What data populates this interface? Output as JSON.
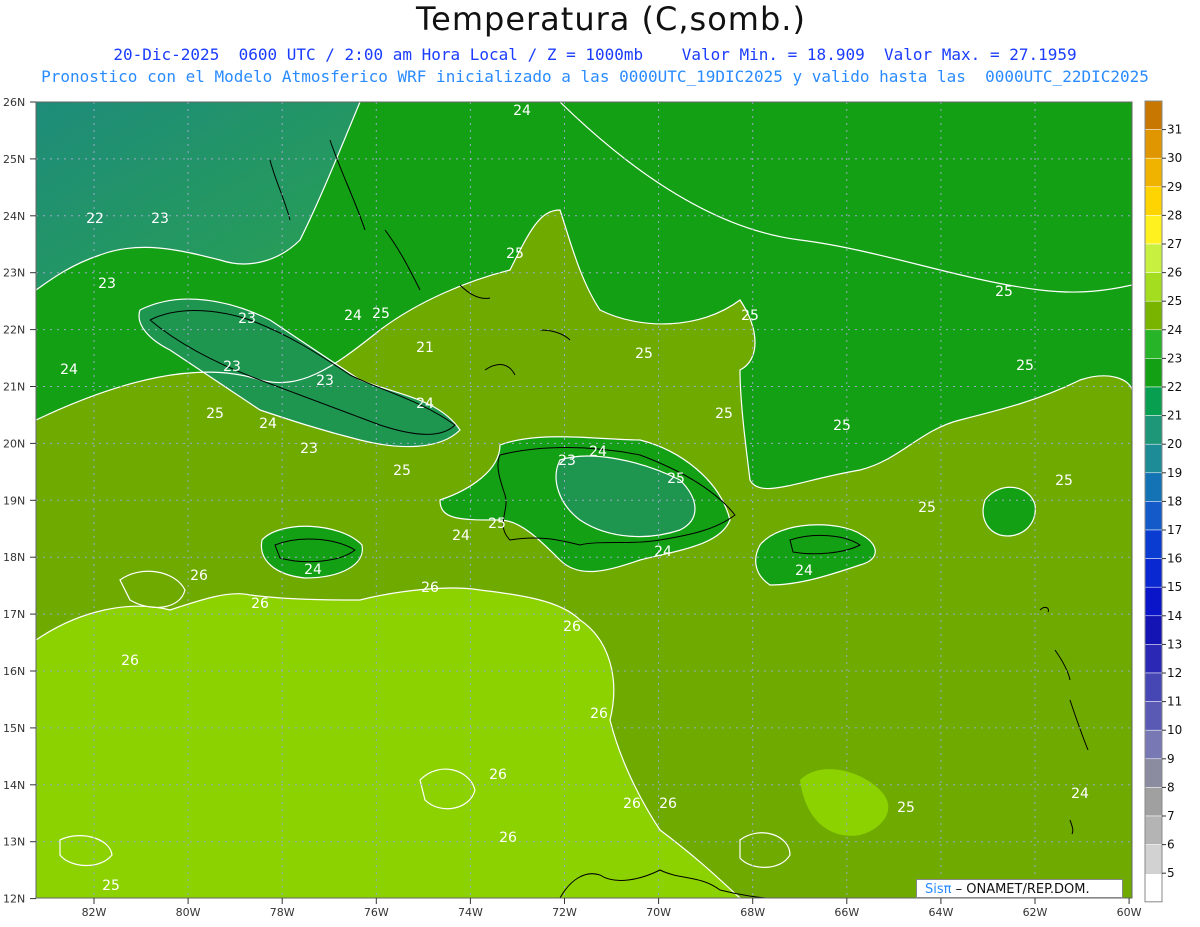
{
  "header": {
    "title": "Temperatura (C,somb.)",
    "line1": "20-Dic-2025  0600 UTC / 2:00 am Hora Local / Z = 1000mb    Valor Min. = 18.909  Valor Max. = 27.1959",
    "line2": "Pronostico con el Modelo Atmosferico WRF inicializado a las 0000UTC_19DIC2025 y valido hasta las  0000UTC_22DIC2025"
  },
  "axes": {
    "lat_labels": [
      "26N",
      "25N",
      "24N",
      "23N",
      "22N",
      "21N",
      "20N",
      "19N",
      "18N",
      "17N",
      "16N",
      "15N",
      "14N",
      "13N",
      "12N"
    ],
    "lon_labels": [
      "82W",
      "80W",
      "78W",
      "76W",
      "74W",
      "72W",
      "70W",
      "68W",
      "66W",
      "64W",
      "62W",
      "60W"
    ]
  },
  "colorbar": {
    "labels": [
      "31",
      "30",
      "29",
      "28",
      "27",
      "26",
      "25",
      "24",
      "23",
      "22",
      "21",
      "20",
      "19",
      "18",
      "17",
      "16",
      "15",
      "14",
      "13",
      "12",
      "11",
      "10",
      "9",
      "8",
      "7",
      "6",
      "5"
    ],
    "colors": [
      "#c87800",
      "#e09600",
      "#f0b400",
      "#ffd400",
      "#fff020",
      "#c8f040",
      "#a4dc20",
      "#78b400",
      "#28b428",
      "#14a014",
      "#08a050",
      "#1e9678",
      "#1e8c96",
      "#1473b4",
      "#145ac8",
      "#0a3cd2",
      "#0a28d2",
      "#0a14c8",
      "#1414b4",
      "#2a28b4",
      "#4646b4",
      "#5a5ab4",
      "#7878b4",
      "#8c8ca0",
      "#a0a0a0",
      "#b4b4b4",
      "#d2d2d2"
    ]
  },
  "contour_labels": [
    {
      "text": "24"
    },
    {
      "text": "22"
    },
    {
      "text": "23"
    },
    {
      "text": "25"
    },
    {
      "text": "23"
    },
    {
      "text": "24"
    },
    {
      "text": "23"
    },
    {
      "text": "25"
    },
    {
      "text": "24"
    },
    {
      "text": "23"
    },
    {
      "text": "21"
    },
    {
      "text": "23"
    },
    {
      "text": "25"
    },
    {
      "text": "25"
    },
    {
      "text": "24"
    },
    {
      "text": "23"
    },
    {
      "text": "25"
    },
    {
      "text": "24"
    },
    {
      "text": "25"
    },
    {
      "text": "23"
    },
    {
      "text": "24"
    },
    {
      "text": "25"
    },
    {
      "text": "25"
    },
    {
      "text": "24"
    },
    {
      "text": "25"
    },
    {
      "text": "25"
    },
    {
      "text": "24"
    },
    {
      "text": "25"
    },
    {
      "text": "25"
    },
    {
      "text": "25"
    },
    {
      "text": "24"
    },
    {
      "text": "26"
    },
    {
      "text": "25"
    },
    {
      "text": "26"
    },
    {
      "text": "26"
    },
    {
      "text": "24"
    },
    {
      "text": "26"
    },
    {
      "text": "26"
    },
    {
      "text": "26"
    },
    {
      "text": "26"
    },
    {
      "text": "26"
    },
    {
      "text": "26"
    },
    {
      "text": "26"
    },
    {
      "text": "25"
    },
    {
      "text": "24"
    },
    {
      "text": "25"
    }
  ],
  "credit": {
    "brand": "Sisπ",
    "text": " –  ONAMET/REP.DOM."
  },
  "colors": {
    "dark_teal": "#1e8c7a",
    "green": "#14a014",
    "olive": "#6faa00",
    "light": "#8cd200"
  }
}
